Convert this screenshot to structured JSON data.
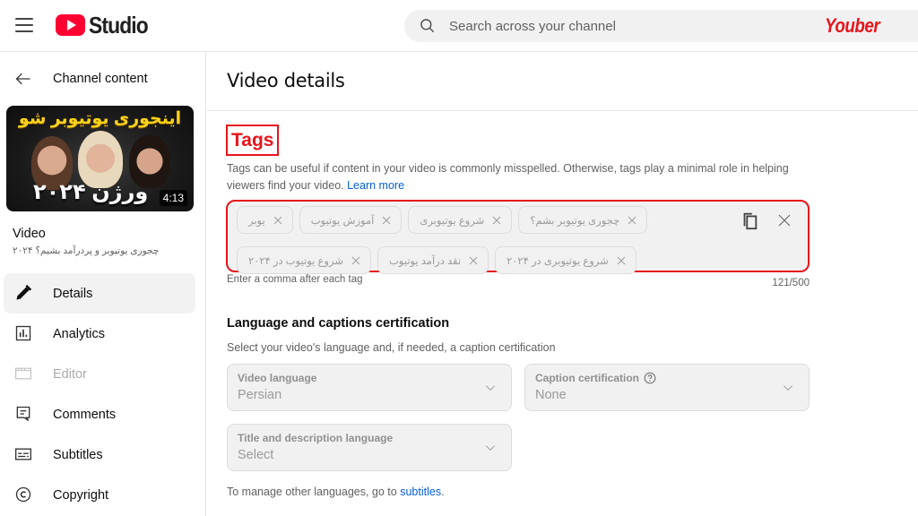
{
  "header": {
    "app_name": "Studio",
    "search_placeholder": "Search across your channel",
    "brand_watermark": "Youber",
    "icons": {
      "menu": "hamburger-menu-icon",
      "logo": "youtube-logo-icon",
      "search": "search-icon"
    }
  },
  "sidebar": {
    "back_label": "Channel content",
    "thumbnail": {
      "headline": "اینجوری یوتیوبر شو",
      "subline": "ورژن ۲۰۲۴",
      "duration": "4:13"
    },
    "video_label": "Video",
    "video_title": "چجوری یوتیوبر و پردرآمد بشیم؟ ۲۰۲۴",
    "nav": [
      {
        "label": "Details",
        "icon": "pencil-icon",
        "active": true,
        "disabled": false
      },
      {
        "label": "Analytics",
        "icon": "analytics-icon",
        "active": false,
        "disabled": false
      },
      {
        "label": "Editor",
        "icon": "editor-icon",
        "active": false,
        "disabled": true
      },
      {
        "label": "Comments",
        "icon": "comments-icon",
        "active": false,
        "disabled": false
      },
      {
        "label": "Subtitles",
        "icon": "subtitles-icon",
        "active": false,
        "disabled": false
      },
      {
        "label": "Copyright",
        "icon": "copyright-icon",
        "active": false,
        "disabled": false
      }
    ]
  },
  "main": {
    "page_title": "Video details",
    "tags": {
      "heading": "Tags",
      "description": "Tags can be useful if content in your video is commonly misspelled. Otherwise, tags play a minimal role in helping viewers find your video.",
      "learn_more": "Learn more",
      "chips": [
        "یوبر",
        "آموزش یوتیوب",
        "شروع یوتیوبری",
        "چجوری یوتیوبر بشم؟",
        "شروع یوتیوب در ۲۰۲۴",
        "نقد درآمد یوتیوب",
        "شروع یوتیوبری در ۲۰۲۴"
      ],
      "hint": "Enter a comma after each tag",
      "count": "121/500"
    },
    "language": {
      "heading": "Language and captions certification",
      "description": "Select your video's language and, if needed, a caption certification",
      "video_language": {
        "label": "Video language",
        "value": "Persian"
      },
      "caption_certification": {
        "label": "Caption certification",
        "value": "None"
      },
      "title_description_language": {
        "label": "Title and description language",
        "value": "Select"
      },
      "manage_text": "To manage other languages, go to",
      "manage_link": "subtitles",
      "manage_suffix": "."
    }
  },
  "colors": {
    "brand_red": "#ff0033",
    "highlight_red": "#e8141b",
    "link_blue": "#065fd4",
    "field_bg": "#f1f1f1"
  }
}
